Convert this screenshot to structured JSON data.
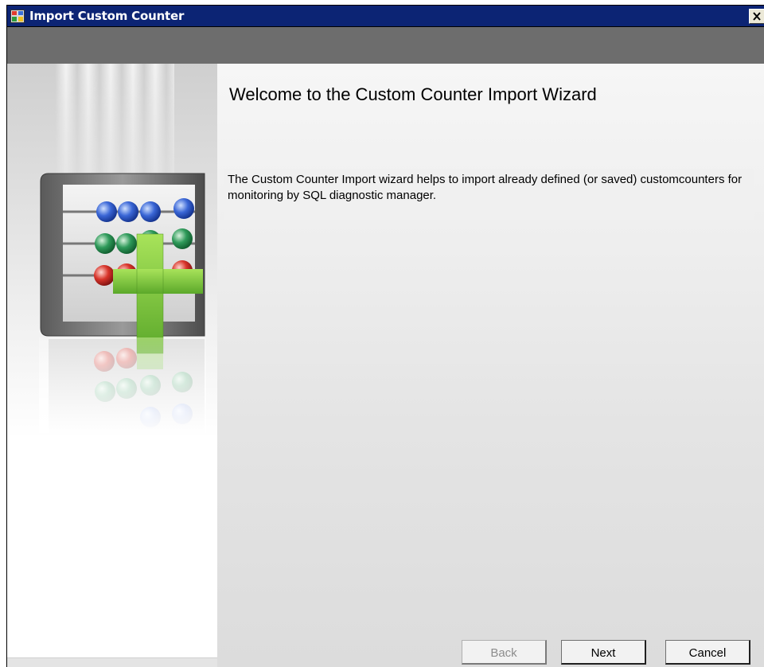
{
  "window": {
    "title": "Import Custom Counter",
    "close_label": "✕"
  },
  "wizard": {
    "title": "Welcome to the Custom Counter Import Wizard",
    "description": "The Custom Counter Import wizard helps to import already defined (or saved) customcounters for monitoring by SQL diagnostic manager."
  },
  "buttons": {
    "back": "Back",
    "next": "Next",
    "cancel": "Cancel"
  },
  "colors": {
    "titlebar": "#0c2474",
    "header_band": "#6d6d6d",
    "plus_green": "#7cc43a"
  },
  "icons": {
    "app": "window-app-icon",
    "close": "close-icon",
    "illustration": "abacus-plus-illustration"
  }
}
